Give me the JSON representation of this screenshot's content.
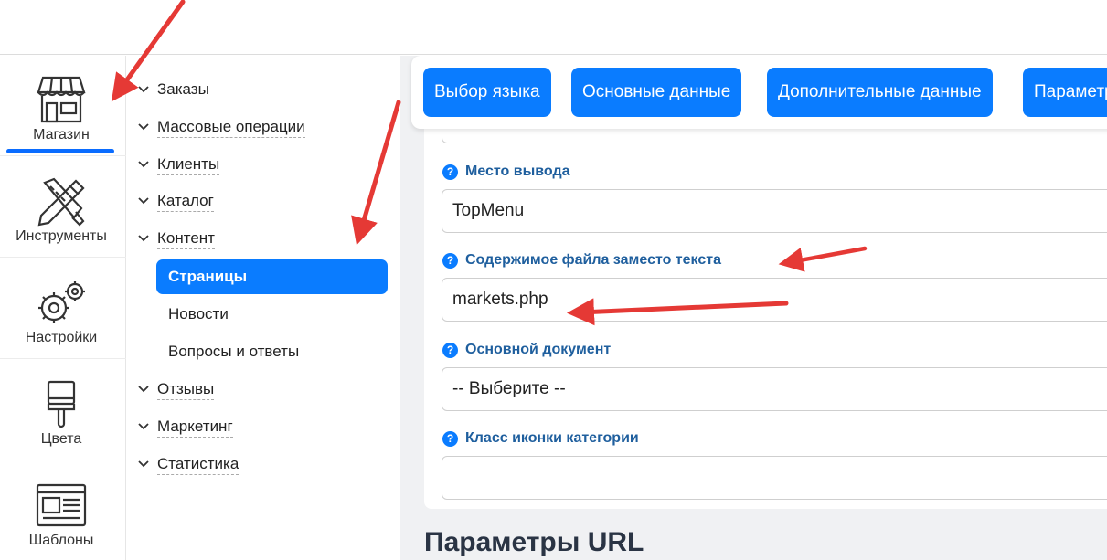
{
  "iconbar": [
    {
      "label": "Магазин",
      "icon": "store-icon",
      "active": true
    },
    {
      "label": "Инструменты",
      "icon": "tools-icon"
    },
    {
      "label": "Настройки",
      "icon": "gears-icon"
    },
    {
      "label": "Цвета",
      "icon": "brush-icon"
    },
    {
      "label": "Шаблоны",
      "icon": "template-icon"
    }
  ],
  "menu": {
    "items": [
      "Заказы",
      "Массовые операции",
      "Клиенты",
      "Каталог",
      "Контент"
    ],
    "sub_items": [
      "Страницы",
      "Новости",
      "Вопросы и ответы"
    ],
    "items_after": [
      "Отзывы",
      "Маркетинг",
      "Статистика"
    ]
  },
  "tabs": [
    "Выбор языка",
    "Основные данные",
    "Дополнительные данные",
    "Параметры"
  ],
  "form": {
    "output_place_label": "Место вывода",
    "output_place_value": "TopMenu",
    "file_content_label": "Содержимое файла заместо текста",
    "file_content_value": "markets.php",
    "main_document_label": "Основной документ",
    "main_document_value": "-- Выберите --",
    "category_icon_label": "Класс иконки категории",
    "category_icon_value": ""
  },
  "section_title": "Параметры URL",
  "colors": {
    "accent": "#0a7cff",
    "annotation_arrow": "#e53935"
  }
}
